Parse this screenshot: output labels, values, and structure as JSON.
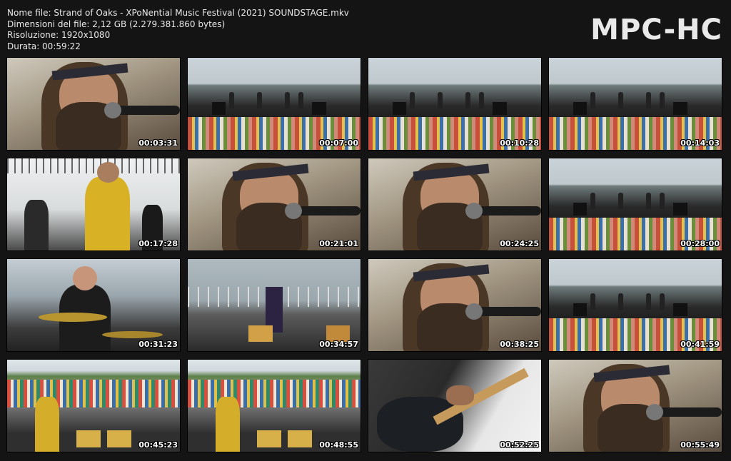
{
  "file_info": {
    "name": "Nome file: Strand of Oaks - XPoNential Music Festival (2021) SOUNDSTAGE.mkv",
    "size": "Dimensioni del file: 2,12 GB (2.279.381.860 bytes)",
    "resolution": "Risoluzione: 1920x1080",
    "duration": "Durata: 00:59:22"
  },
  "logo": "MPC-HC",
  "thumbnails": [
    {
      "time": "00:03:31",
      "scene": "closeup-singer"
    },
    {
      "time": "00:07:00",
      "scene": "wide-stage-crowd"
    },
    {
      "time": "00:10:28",
      "scene": "wide-stage-crowd"
    },
    {
      "time": "00:14:03",
      "scene": "wide-stage-crowd"
    },
    {
      "time": "00:17:28",
      "scene": "guitarist-yellow"
    },
    {
      "time": "00:21:01",
      "scene": "closeup-singer"
    },
    {
      "time": "00:24:25",
      "scene": "closeup-singer"
    },
    {
      "time": "00:28:00",
      "scene": "wide-stage-crowd"
    },
    {
      "time": "00:31:23",
      "scene": "drummer"
    },
    {
      "time": "00:34:57",
      "scene": "solo-stage"
    },
    {
      "time": "00:38:25",
      "scene": "closeup-singer"
    },
    {
      "time": "00:41:59",
      "scene": "wide-stage-crowd"
    },
    {
      "time": "00:45:23",
      "scene": "wide-crowd-behind"
    },
    {
      "time": "00:48:55",
      "scene": "wide-crowd-behind"
    },
    {
      "time": "00:52:25",
      "scene": "guitar-closeup"
    },
    {
      "time": "00:55:49",
      "scene": "closeup-singer"
    }
  ],
  "watermark": "xponential music festival"
}
